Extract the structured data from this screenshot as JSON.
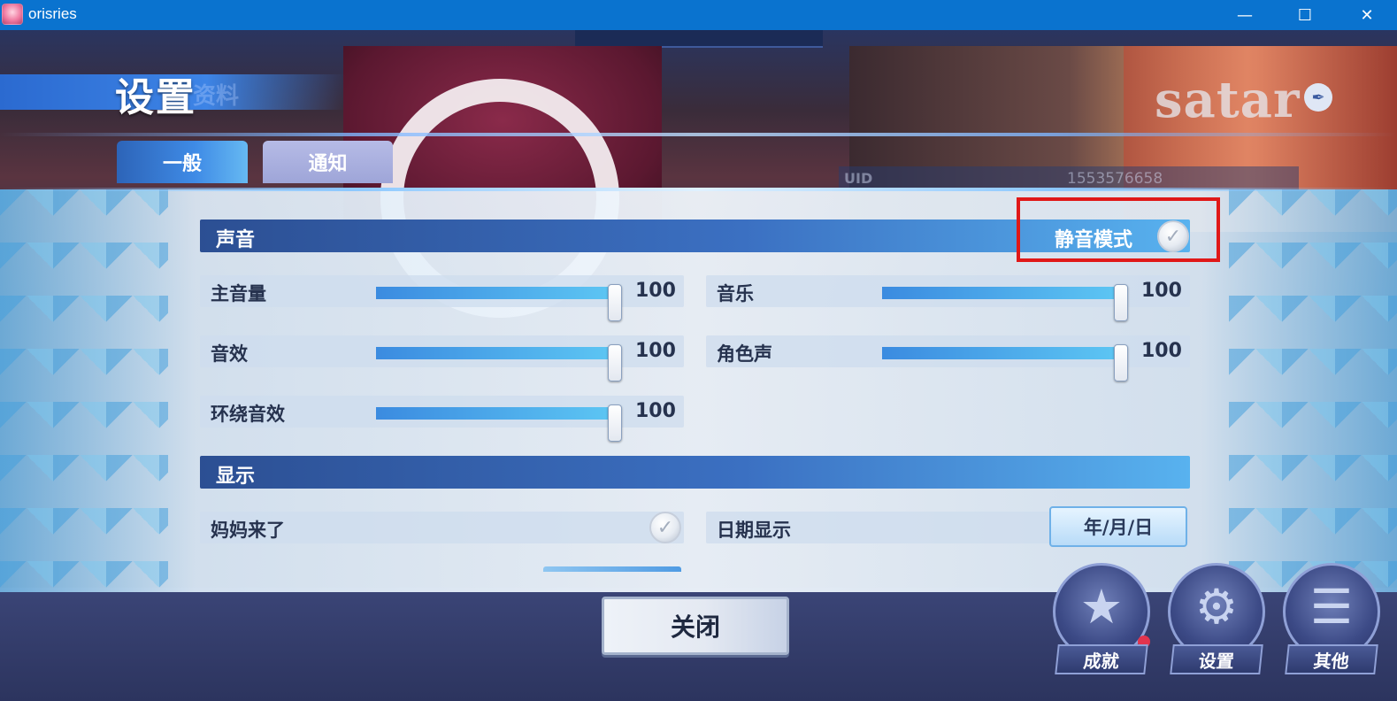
{
  "window": {
    "title": "orisries",
    "minimize": "—",
    "maximize": "☐",
    "close": "✕"
  },
  "header": {
    "title": "设置",
    "ghost_text": "资料",
    "logo_text": "satar",
    "logo_badge_icon": "quill-icon"
  },
  "tabs": [
    {
      "label": "一般",
      "active": true
    },
    {
      "label": "通知",
      "active": false
    }
  ],
  "background": {
    "uid_label": "UID",
    "uid_value": "1553576658"
  },
  "sound": {
    "section_label": "声音",
    "mute_label": "静音模式",
    "mute_checked": false,
    "sliders": [
      {
        "label": "主音量",
        "value": 100
      },
      {
        "label": "音乐",
        "value": 100
      },
      {
        "label": "音效",
        "value": 100
      },
      {
        "label": "角色声",
        "value": 100
      },
      {
        "label": "环绕音效",
        "value": 100
      }
    ]
  },
  "display": {
    "section_label": "显示",
    "mom_label": "妈妈来了",
    "mom_checked": false,
    "date_label": "日期显示",
    "date_format": "年/月/日"
  },
  "close_button": "关闭",
  "menu": [
    {
      "label": "成就",
      "icon": "star-icon",
      "badge": true
    },
    {
      "label": "设置",
      "icon": "gear-icon",
      "badge": false
    },
    {
      "label": "其他",
      "icon": "list-icon",
      "badge": false
    }
  ],
  "colors": {
    "titlebar": "#0a73cf",
    "section_gradient_start": "#2c4f93",
    "section_gradient_end": "#58b2ef",
    "slider_fill": "#5ec8f4",
    "highlight": "#e01818"
  }
}
